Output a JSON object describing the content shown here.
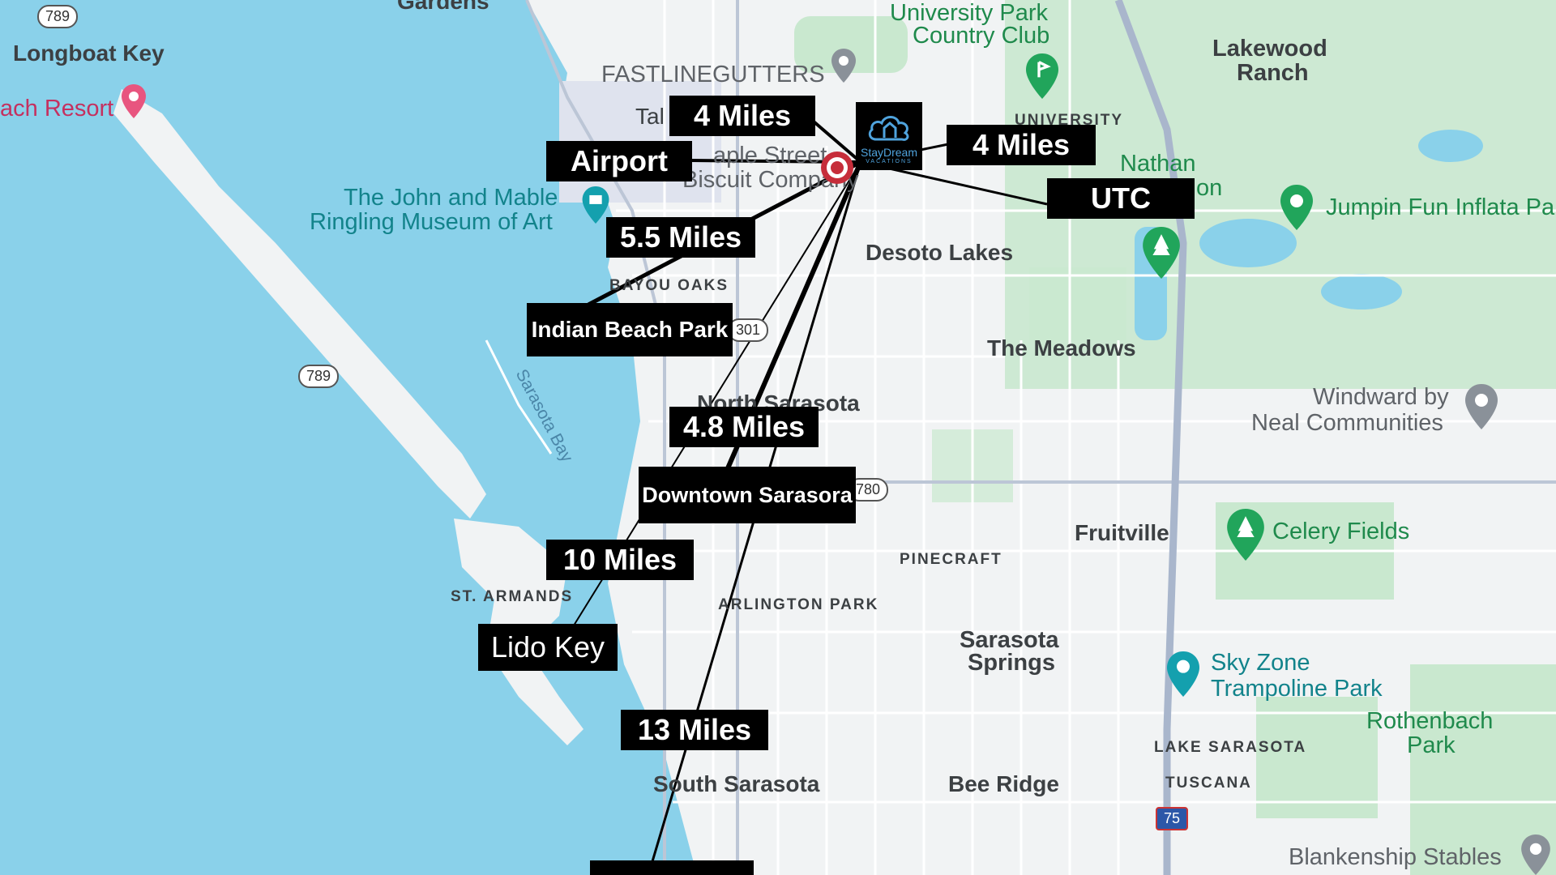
{
  "map": {
    "colors": {
      "water": "#8ad1ea",
      "land": "#f1f3f4",
      "park": "#c9e8cf",
      "road": "#ffffff",
      "highway": "#a9b6cc",
      "callout_bg": "#000000",
      "callout_text": "#ffffff",
      "route_line": "#000000"
    },
    "brand_logo": {
      "name": "StayDream",
      "sub": "VACATIONS"
    },
    "callouts": {
      "dist_top": "4 Miles",
      "airport": "Airport",
      "dist_right": "4 Miles",
      "utc": "UTC",
      "dist_5_5": "5.5 Miles",
      "indian_beach_park": "Indian Beach Park",
      "dist_4_8": "4.8 Miles",
      "downtown": "Downtown Sarasora",
      "dist_10": "10 Miles",
      "lido_key": "Lido Key",
      "dist_13": "13 Miles"
    },
    "places": {
      "longboat_key": "Longboat Key",
      "beach_resort": "ach Resort",
      "fastline": "FASTLINEGUTTERS",
      "tal": "Tal",
      "maple_street": "aple Street",
      "biscuit_company": "Biscuit Company",
      "ringling_1": "The John and Mable",
      "ringling_2": "Ringling Museum of Art",
      "university_park_1": "University Park",
      "university_park_2": "Country Club",
      "university": "UNIVERSITY",
      "lakewood_1": "Lakewood",
      "lakewood_2": "Ranch",
      "nathan": "Nathan",
      "nathan_2": "on",
      "jumpin": "Jumpin Fun Inflata Pa",
      "desoto_lakes": "Desoto Lakes",
      "bayou_oaks": "BAYOU OAKS",
      "the_meadows": "The Meadows",
      "sarasota_bay": "Sarasota Bay",
      "north_sarasota": "North Sarasota",
      "windward_1": "Windward by",
      "windward_2": "Neal Communities",
      "fruitville": "Fruitville",
      "celery_fields": "Celery Fields",
      "pinecraft": "PINECRAFT",
      "st_armands": "ST. ARMANDS",
      "arlington_park": "ARLINGTON PARK",
      "sarasota_springs_1": "Sarasota",
      "sarasota_springs_2": "Springs",
      "sky_zone_1": "Sky Zone",
      "sky_zone_2": "Trampoline Park",
      "rothenbach_1": "Rothenbach",
      "rothenbach_2": "Park",
      "lake_sarasota": "LAKE SARASOTA",
      "tuscana": "TUSCANA",
      "south_sarasota": "South Sarasota",
      "bee_ridge": "Bee Ridge",
      "blankenship": "Blankenship Stables",
      "gardens_partial": "Gardens"
    },
    "shields": {
      "sr789_top": "789",
      "sr789_mid": "789",
      "us301": "301",
      "sr780": "780",
      "i75": "75"
    }
  }
}
